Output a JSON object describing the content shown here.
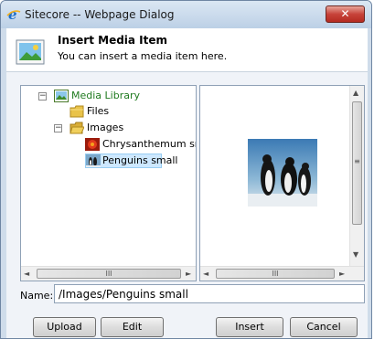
{
  "window": {
    "title": "Sitecore -- Webpage Dialog",
    "close_glyph": "✕"
  },
  "header": {
    "title": "Insert Media Item",
    "subtitle": "You can insert a media item here."
  },
  "tree": {
    "items": [
      {
        "label": "Media Library",
        "icon": "media-library-icon",
        "expander": "−"
      },
      {
        "label": "Files",
        "icon": "folder-icon"
      },
      {
        "label": "Images",
        "icon": "folder-open-icon",
        "expander": "−"
      },
      {
        "label": "Chrysanthemum small",
        "icon": "flower-image-icon"
      },
      {
        "label": "Penguins small",
        "icon": "penguin-image-icon",
        "selected": true
      }
    ]
  },
  "scroll": {
    "h_grip": "III",
    "v_grip": "≡",
    "left_arrow": "◄",
    "right_arrow": "►",
    "up_arrow": "▲",
    "down_arrow": "▼"
  },
  "name_field": {
    "label": "Name:",
    "value": "/Images/Penguins small"
  },
  "buttons": {
    "upload": "Upload",
    "edit": "Edit",
    "insert": "Insert",
    "cancel": "Cancel"
  },
  "colors": {
    "tree_text": "#1f7a1f",
    "selection": "#cde8ff",
    "close": "#c7433a"
  }
}
